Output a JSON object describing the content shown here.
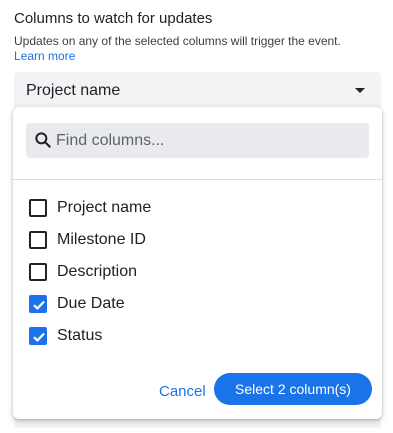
{
  "header": {
    "title": "Columns to watch for updates",
    "subtitle": "Updates on any of the selected columns will trigger the event.",
    "learn_more": "Learn more"
  },
  "select": {
    "value": "Project name"
  },
  "dropdown": {
    "search_placeholder": "Find columns...",
    "options": [
      {
        "label": "Project name",
        "checked": false
      },
      {
        "label": "Milestone ID",
        "checked": false
      },
      {
        "label": "Description",
        "checked": false
      },
      {
        "label": "Due Date",
        "checked": true
      },
      {
        "label": "Status",
        "checked": true
      }
    ],
    "cancel_label": "Cancel",
    "confirm_label": "Select 2 column(s)"
  },
  "colors": {
    "accent": "#1a73e8",
    "field_bg": "#f1f3f4",
    "search_bg": "#e8eaed"
  },
  "icons": {
    "search": "search-icon",
    "caret": "caret-down-icon",
    "check": "check-icon"
  }
}
